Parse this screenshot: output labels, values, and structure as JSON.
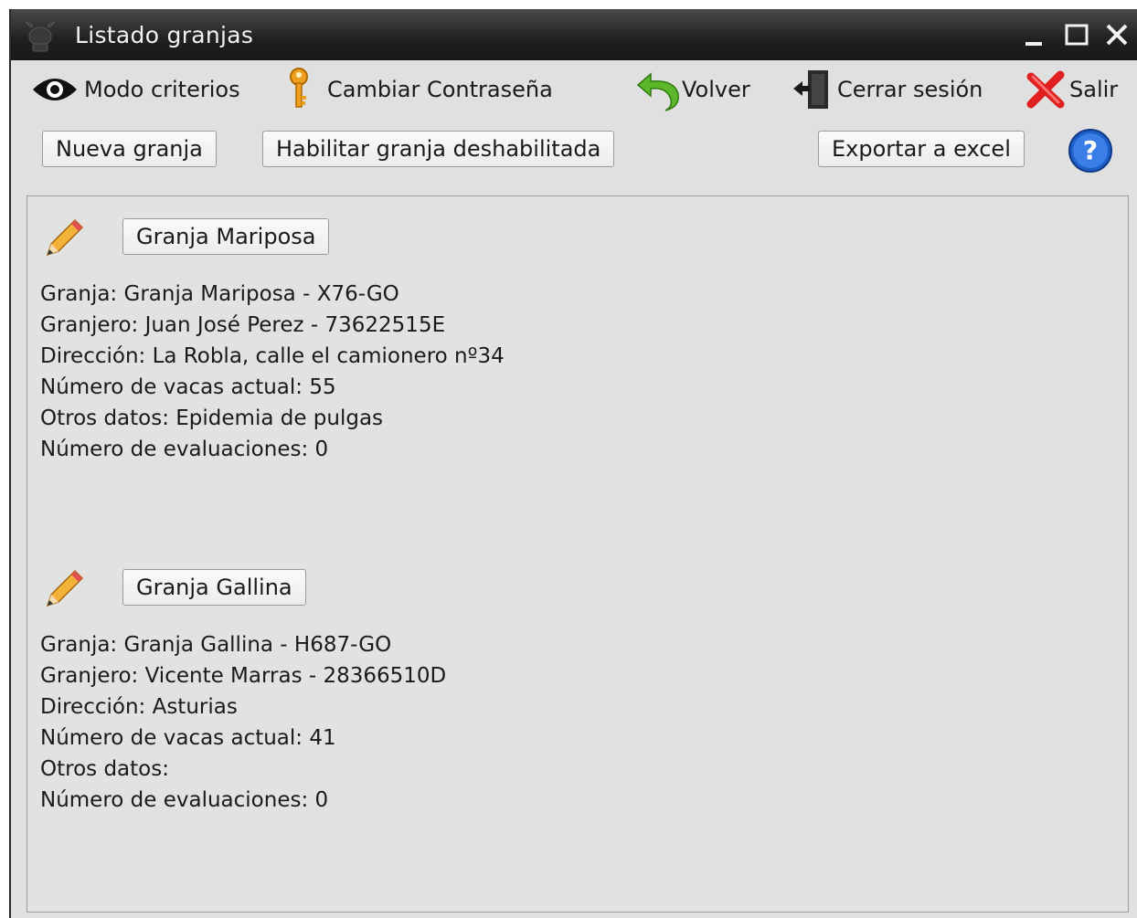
{
  "window": {
    "title": "Listado granjas",
    "controls": [
      "minimize",
      "maximize",
      "close"
    ]
  },
  "menu": {
    "items": [
      {
        "label": "Modo criterios",
        "icon": "eye-icon"
      },
      {
        "label": "Cambiar Contraseña",
        "icon": "key-icon"
      },
      {
        "label": "Volver",
        "icon": "back-arrow-icon"
      },
      {
        "label": "Cerrar sesión",
        "icon": "logout-door-icon"
      },
      {
        "label": "Salir",
        "icon": "red-x-icon"
      }
    ]
  },
  "toolbar": {
    "new_farm": "Nueva granja",
    "enable_disabled": "Habilitar granja deshabilitada",
    "export_excel": "Exportar a excel",
    "help_icon": "help-icon"
  },
  "farms": [
    {
      "button": "Granja Mariposa",
      "details": [
        "Granja: Granja Mariposa - X76-GO",
        "Granjero: Juan José Perez - 73622515E",
        "Dirección: La Robla, calle el camionero nº34",
        "Número de vacas actual: 55",
        "Otros datos: Epidemia de pulgas",
        "Número de evaluaciones: 0"
      ]
    },
    {
      "button": "Granja Gallina",
      "details": [
        "Granja: Granja Gallina - H687-GO",
        "Granjero: Vicente Marras - 28366510D",
        "Dirección: Asturias",
        "Número de vacas actual: 41",
        "Otros datos:",
        "Número de evaluaciones: 0"
      ]
    }
  ],
  "colors": {
    "titlebar": "#202020",
    "window_bg": "#e0e0e0",
    "content_bg": "#e2e2e2",
    "help_blue": "#1e5fc8",
    "exit_red": "#e02020",
    "back_green": "#5cb82a",
    "key_orange": "#f0a020"
  }
}
